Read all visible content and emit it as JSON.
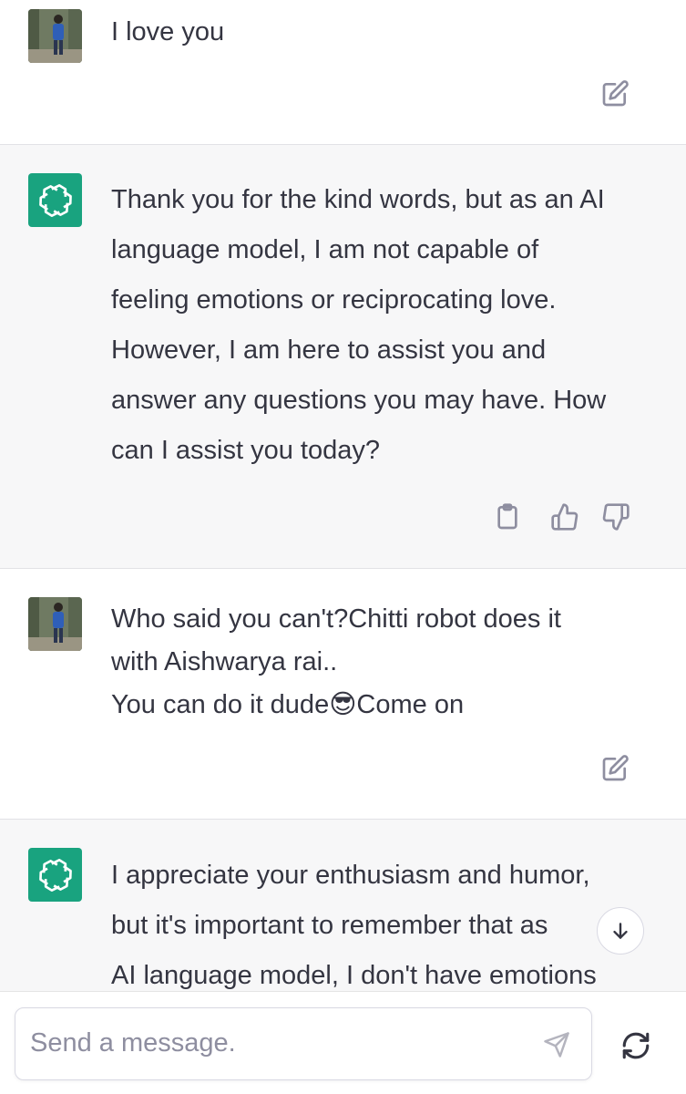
{
  "conversation": [
    {
      "role": "user",
      "text": "I love you"
    },
    {
      "role": "assistant",
      "text": "Thank you for the kind words, but as an AI\nlanguage model, I am not capable of\nfeeling emotions or reciprocating love.\nHowever, I am here to assist you and\nanswer any questions you may have. How\ncan I assist you today?"
    },
    {
      "role": "user",
      "text": "Who said you can't?Chitti robot does it\nwith Aishwarya rai..\nYou can do it dude😎Come on"
    },
    {
      "role": "assistant",
      "text": "I appreciate your enthusiasm and humor,\nbut it's important to remember that as\nAI language model, I don't have emotions"
    }
  ],
  "icons": {
    "edit": "edit-icon",
    "copy": "clipboard-icon",
    "like": "thumbs-up-icon",
    "dislike": "thumbs-down-icon",
    "scroll": "arrow-down-icon",
    "send": "send-icon",
    "regenerate": "regenerate-icon",
    "bot": "openai-logo-icon"
  },
  "colors": {
    "bot_avatar": "#19a37f",
    "assistant_bg": "#f7f7f8",
    "text": "#343541",
    "icon": "#8e8ea0"
  },
  "composer": {
    "placeholder": "Send a message."
  }
}
